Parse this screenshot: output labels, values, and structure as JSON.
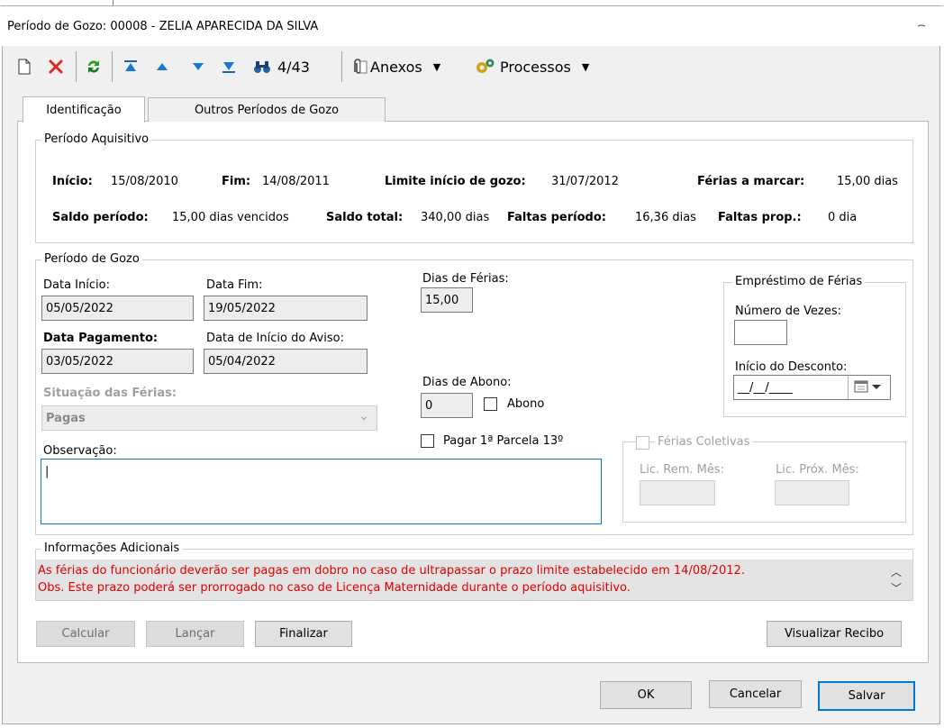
{
  "window": {
    "title": "Período de Gozo: 00008 - ZELIA APARECIDA DA SILVA",
    "close_glyph": "⌢"
  },
  "toolbar": {
    "record_position": "4/43",
    "attachments_label": "Anexos",
    "processes_label": "Processos"
  },
  "tabs": [
    {
      "label": "Identificação"
    },
    {
      "label": "Outros Períodos de Gozo"
    }
  ],
  "periodo_aquisitivo": {
    "title": "Período Aquisitivo",
    "inicio_label": "Início:",
    "inicio_value": "15/08/2010",
    "fim_label": "Fim:",
    "fim_value": "14/08/2011",
    "limite_label": "Limite início de gozo:",
    "limite_value": "31/07/2012",
    "ferias_marcar_label": "Férias a marcar:",
    "ferias_marcar_value": "15,00 dias",
    "saldo_periodo_label": "Saldo período:",
    "saldo_periodo_value": "15,00 dias vencidos",
    "saldo_total_label": "Saldo total:",
    "saldo_total_value": "340,00 dias",
    "faltas_periodo_label": "Faltas período:",
    "faltas_periodo_value": "16,36 dias",
    "faltas_prop_label": "Faltas prop.:",
    "faltas_prop_value": "0 dia"
  },
  "periodo_gozo": {
    "title": "Período de Gozo",
    "data_inicio_label": "Data Início:",
    "data_inicio_value": "05/05/2022",
    "data_fim_label": "Data Fim:",
    "data_fim_value": "19/05/2022",
    "dias_ferias_label": "Dias de Férias:",
    "dias_ferias_value": "15,00",
    "data_pagamento_label": "Data Pagamento:",
    "data_pagamento_value": "03/05/2022",
    "data_aviso_label": "Data de Início do Aviso:",
    "data_aviso_value": "05/04/2022",
    "dias_abono_label": "Dias de Abono:",
    "dias_abono_value": "0",
    "abono_label": "Abono",
    "situacao_label": "Situação das Férias:",
    "situacao_value": "Pagas",
    "pagar_parcela_label": "Pagar 1ª Parcela 13º",
    "observacao_label": "Observação:",
    "observacao_value": "|"
  },
  "emprestimo": {
    "title": "Empréstimo de Férias",
    "numero_vezes_label": "Número de Vezes:",
    "numero_vezes_value": "",
    "inicio_desconto_label": "Início do Desconto:",
    "inicio_desconto_value": "__/__/____"
  },
  "ferias_coletivas": {
    "title": "Férias Coletivas",
    "lic_rem_label": "Lic. Rem. Mês:",
    "lic_prox_label": "Lic. Próx. Mês:"
  },
  "info_adicionais": {
    "title": "Informações Adicionais",
    "line1": "As férias do funcionário deverão ser pagas em dobro no caso de ultrapassar o prazo limite estabelecido em 14/08/2012.",
    "line2": "Obs. Este prazo poderá ser prorrogado no caso de Licença Maternidade durante o período aquisitivo."
  },
  "actions": {
    "calcular": "Calcular",
    "lancar": "Lançar",
    "finalizar": "Finalizar",
    "visualizar_recibo": "Visualizar Recibo"
  },
  "footer": {
    "ok": "OK",
    "cancelar": "Cancelar",
    "salvar": "Salvar"
  },
  "colors": {
    "error_text": "#e00000",
    "focus_border": "#0078d7"
  }
}
